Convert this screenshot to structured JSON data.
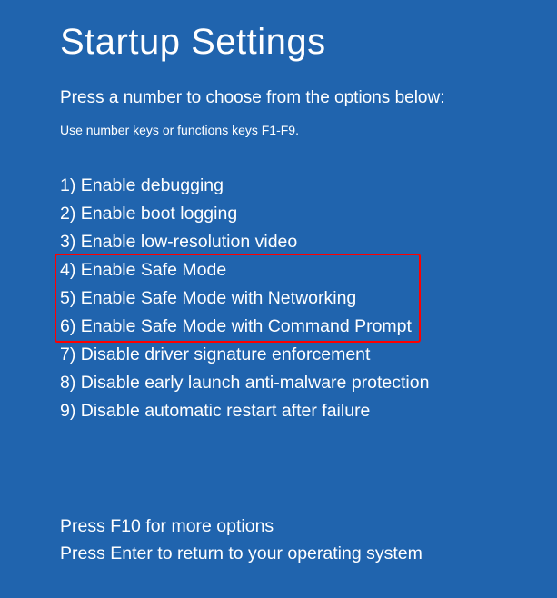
{
  "title": "Startup Settings",
  "subtitle": "Press a number to choose from the options below:",
  "hint": "Use number keys or functions keys F1-F9.",
  "options": [
    {
      "num": "1)",
      "label": "Enable debugging"
    },
    {
      "num": "2)",
      "label": "Enable boot logging"
    },
    {
      "num": "3)",
      "label": "Enable low-resolution video"
    },
    {
      "num": "4)",
      "label": "Enable Safe Mode"
    },
    {
      "num": "5)",
      "label": "Enable Safe Mode with Networking"
    },
    {
      "num": "6)",
      "label": "Enable Safe Mode with Command Prompt"
    },
    {
      "num": "7)",
      "label": "Disable driver signature enforcement"
    },
    {
      "num": "8)",
      "label": "Disable early launch anti-malware protection"
    },
    {
      "num": "9)",
      "label": "Disable automatic restart after failure"
    }
  ],
  "footer": {
    "more": "Press F10 for more options",
    "return": "Press Enter to return to your operating system"
  },
  "highlight": {
    "start": 3,
    "end": 5
  }
}
